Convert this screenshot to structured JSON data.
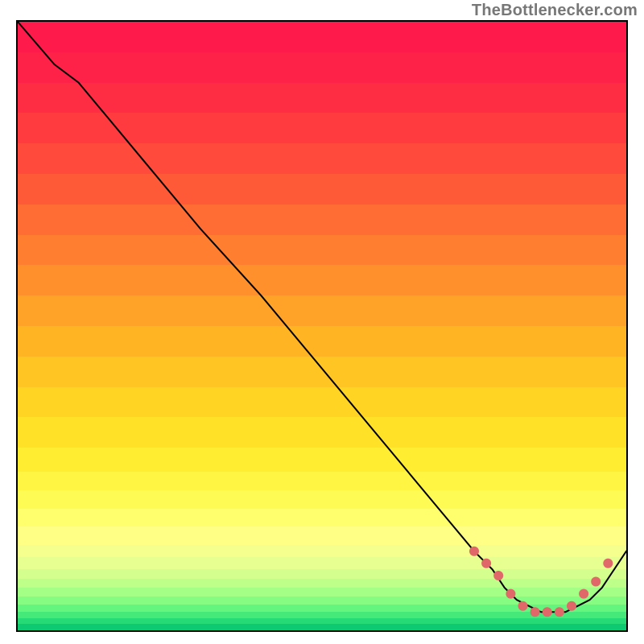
{
  "source_label": "TheBottlenecker.com",
  "chart_data": {
    "type": "line",
    "title": "",
    "xlabel": "",
    "ylabel": "",
    "xlim": [
      0,
      100
    ],
    "ylim": [
      0,
      100
    ],
    "grid": false,
    "legend": false,
    "series": [
      {
        "name": "bottleneck-curve",
        "x": [
          0,
          6,
          10,
          20,
          30,
          40,
          50,
          60,
          70,
          75,
          78,
          80,
          82,
          84,
          86,
          88,
          90,
          92,
          94,
          96,
          98,
          100
        ],
        "values": [
          100,
          93,
          90,
          78,
          66,
          55,
          43,
          31,
          19,
          13,
          10,
          7,
          5,
          4,
          3,
          3,
          3,
          4,
          5,
          7,
          10,
          13
        ]
      }
    ],
    "markers": {
      "name": "optimal-range-markers",
      "color": "#e06868",
      "x": [
        75,
        77,
        79,
        81,
        83,
        85,
        87,
        89,
        91,
        93,
        95,
        97
      ],
      "values": [
        13,
        11,
        9,
        6,
        4,
        3,
        3,
        3,
        4,
        6,
        8,
        11
      ]
    },
    "background_gradient_bands": [
      {
        "from": 0.0,
        "to": 0.05,
        "color": "#ff1a4c"
      },
      {
        "from": 0.05,
        "to": 0.1,
        "color": "#ff2248"
      },
      {
        "from": 0.1,
        "to": 0.15,
        "color": "#ff2d44"
      },
      {
        "from": 0.15,
        "to": 0.2,
        "color": "#ff3b40"
      },
      {
        "from": 0.2,
        "to": 0.25,
        "color": "#ff4a3c"
      },
      {
        "from": 0.25,
        "to": 0.3,
        "color": "#ff5a38"
      },
      {
        "from": 0.3,
        "to": 0.35,
        "color": "#ff6c34"
      },
      {
        "from": 0.35,
        "to": 0.4,
        "color": "#ff7e30"
      },
      {
        "from": 0.4,
        "to": 0.45,
        "color": "#ff902c"
      },
      {
        "from": 0.45,
        "to": 0.5,
        "color": "#ffa228"
      },
      {
        "from": 0.5,
        "to": 0.55,
        "color": "#ffb424"
      },
      {
        "from": 0.55,
        "to": 0.6,
        "color": "#ffc522"
      },
      {
        "from": 0.6,
        "to": 0.65,
        "color": "#ffd422"
      },
      {
        "from": 0.65,
        "to": 0.7,
        "color": "#ffe228"
      },
      {
        "from": 0.7,
        "to": 0.74,
        "color": "#ffed32"
      },
      {
        "from": 0.74,
        "to": 0.77,
        "color": "#fff542"
      },
      {
        "from": 0.77,
        "to": 0.8,
        "color": "#fffb55"
      },
      {
        "from": 0.8,
        "to": 0.83,
        "color": "#fffe6c"
      },
      {
        "from": 0.83,
        "to": 0.86,
        "color": "#feff84"
      },
      {
        "from": 0.86,
        "to": 0.88,
        "color": "#f4ff8e"
      },
      {
        "from": 0.88,
        "to": 0.9,
        "color": "#e6ff90"
      },
      {
        "from": 0.9,
        "to": 0.915,
        "color": "#d4ff8e"
      },
      {
        "from": 0.915,
        "to": 0.93,
        "color": "#beff8a"
      },
      {
        "from": 0.93,
        "to": 0.945,
        "color": "#a4ff86"
      },
      {
        "from": 0.945,
        "to": 0.958,
        "color": "#86fd82"
      },
      {
        "from": 0.958,
        "to": 0.97,
        "color": "#64f57e"
      },
      {
        "from": 0.97,
        "to": 0.98,
        "color": "#44e97a"
      },
      {
        "from": 0.98,
        "to": 0.99,
        "color": "#26da76"
      },
      {
        "from": 0.99,
        "to": 1.0,
        "color": "#0fc872"
      }
    ]
  }
}
